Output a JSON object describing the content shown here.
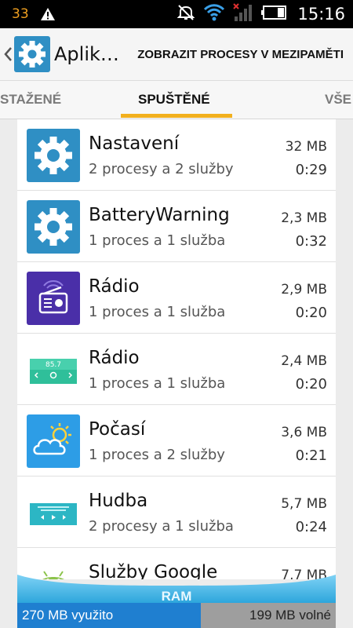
{
  "status_bar": {
    "battery_level": "33",
    "time": "15:16",
    "icons": [
      "warning-icon",
      "mute-icon",
      "wifi-icon",
      "signal-icon",
      "battery-icon"
    ]
  },
  "action_bar": {
    "title": "Aplik…",
    "action_label": "ZOBRAZIT PROCESY V MEZIPAMĚTI"
  },
  "tabs": [
    {
      "label": "STAŽENÉ",
      "active": false
    },
    {
      "label": "SPUŠTĚNÉ",
      "active": true
    },
    {
      "label": "VŠE",
      "active": false
    }
  ],
  "apps": [
    {
      "name": "Nastavení",
      "detail": "2 procesy a 2 služby",
      "size": "32 MB",
      "time": "0:29",
      "icon": "settings-icon"
    },
    {
      "name": "BatteryWarning",
      "detail": "1 proces a 1 služba",
      "size": "2,3 MB",
      "time": "0:32",
      "icon": "settings-icon"
    },
    {
      "name": "Rádio",
      "detail": "1 proces a 1 služba",
      "size": "2,9 MB",
      "time": "0:20",
      "icon": "radio-icon"
    },
    {
      "name": "Rádio",
      "detail": "1 proces a 1 služba",
      "size": "2,4 MB",
      "time": "0:20",
      "icon": "fm-radio-icon"
    },
    {
      "name": "Počasí",
      "detail": "1 proces a 2 služby",
      "size": "3,6 MB",
      "time": "0:21",
      "icon": "weather-icon"
    },
    {
      "name": "Hudba",
      "detail": "2 procesy a 1 služba",
      "size": "5,7 MB",
      "time": "0:24",
      "icon": "music-icon"
    },
    {
      "name": "Služby Google",
      "detail": "",
      "size": "7,7 MB",
      "time": "",
      "icon": "android-icon"
    }
  ],
  "fm_display": "85.7",
  "ram": {
    "label": "RAM",
    "used": "270 MB využito",
    "free": "199 MB volné"
  },
  "colors": {
    "accent_tab": "#f2b01e",
    "ram_used": "#1f7fd0",
    "ram_free": "#9e9e9e",
    "settings_icon_bg": "#2f8fc4"
  }
}
